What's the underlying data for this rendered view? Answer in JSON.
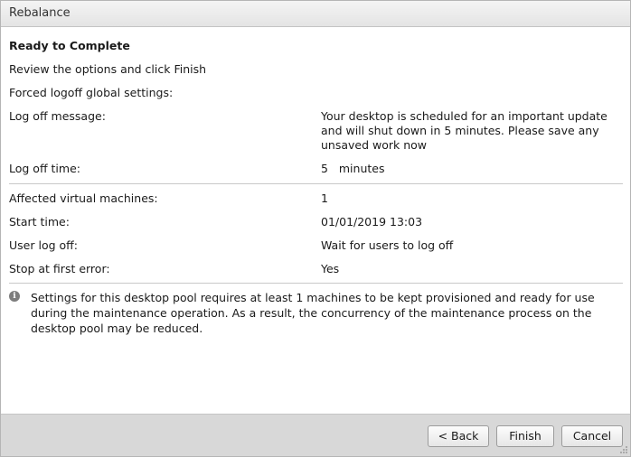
{
  "window": {
    "title": "Rebalance"
  },
  "content": {
    "heading": "Ready to Complete",
    "intro": "Review the options and click Finish",
    "forced_logoff": "Forced logoff global settings:",
    "rows": [
      {
        "label": "Log off message:",
        "value": "Your desktop is scheduled for an important update and will shut down in 5 minutes. Please save any unsaved work now"
      },
      {
        "label": "Log off time:",
        "value": "5   minutes"
      },
      {
        "label": "Affected virtual machines:",
        "value": "1"
      },
      {
        "label": "Start time:",
        "value": "01/01/2019 13:03"
      },
      {
        "label": "User log off:",
        "value": "Wait for users to log off"
      },
      {
        "label": "Stop at first error:",
        "value": "Yes"
      }
    ],
    "info_icon": "info-icon",
    "info_text": "Settings for this desktop pool requires at least 1 machines to be kept provisioned and ready for use during the maintenance operation. As a result, the concurrency of the maintenance process on the desktop pool may be reduced."
  },
  "footer": {
    "back_label": "< Back",
    "finish_label": "Finish",
    "cancel_label": "Cancel"
  }
}
